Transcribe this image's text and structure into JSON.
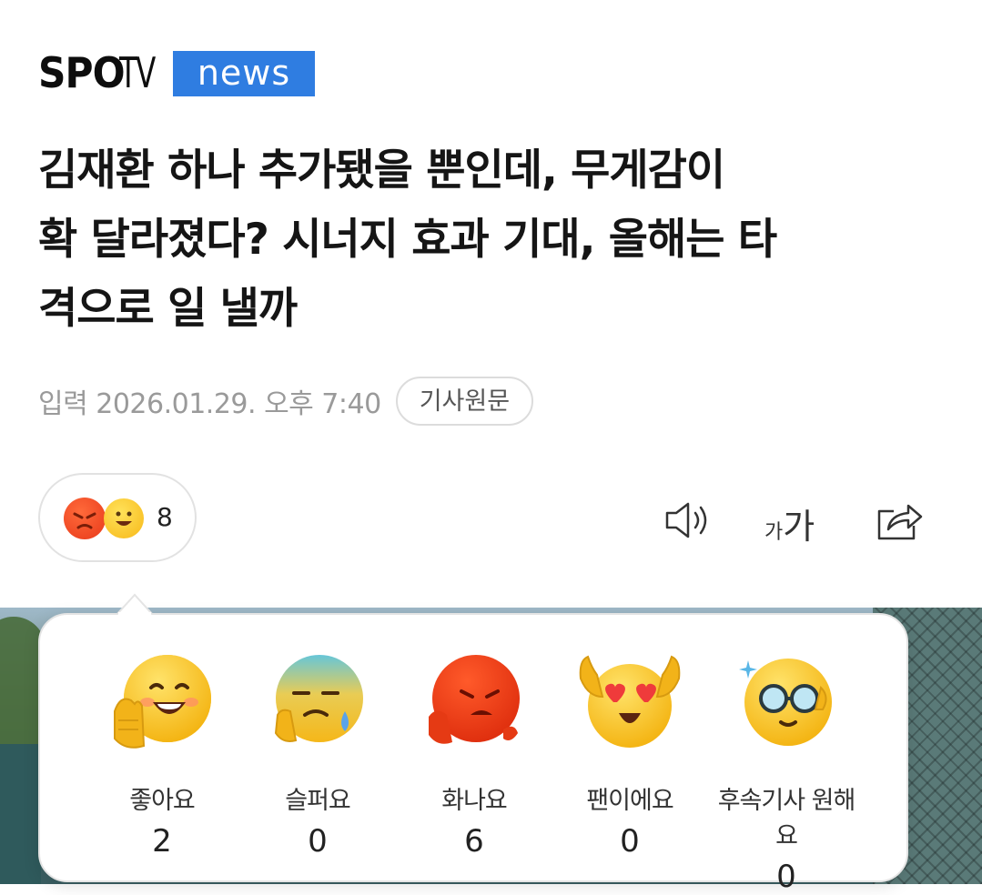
{
  "brand": {
    "logo_part1": "SPO",
    "logo_part2": "TV",
    "logo_part3": "news",
    "accent": "#2f7de1"
  },
  "article": {
    "title_line1": "김재환 하나 추가됐을 뿐인데, 무게감이",
    "title_line2": "확 달라졌다? 시너지 효과 기대, 올해는 타",
    "title_line3": "격으로 일 낼까",
    "meta": "입력 2026.01.29. 오후 7:40",
    "original_button": "기사원문"
  },
  "reaction_summary": {
    "count": "8",
    "icons": [
      "angry-emoji-icon",
      "happy-emoji-icon"
    ]
  },
  "toolbar": {
    "speaker_icon": "speaker-icon",
    "font_small": "가",
    "font_big": "가",
    "share_icon": "share-icon"
  },
  "reactions": [
    {
      "label": "좋아요",
      "count": "2",
      "icon": "thumbs-up-emoji-icon"
    },
    {
      "label": "슬퍼요",
      "count": "0",
      "icon": "sad-emoji-icon"
    },
    {
      "label": "화나요",
      "count": "6",
      "icon": "angry-emoji-icon"
    },
    {
      "label": "팬이에요",
      "count": "0",
      "icon": "heart-eyes-emoji-icon"
    },
    {
      "label": "후속기사 원해요",
      "count": "0",
      "icon": "glasses-emoji-icon"
    }
  ]
}
